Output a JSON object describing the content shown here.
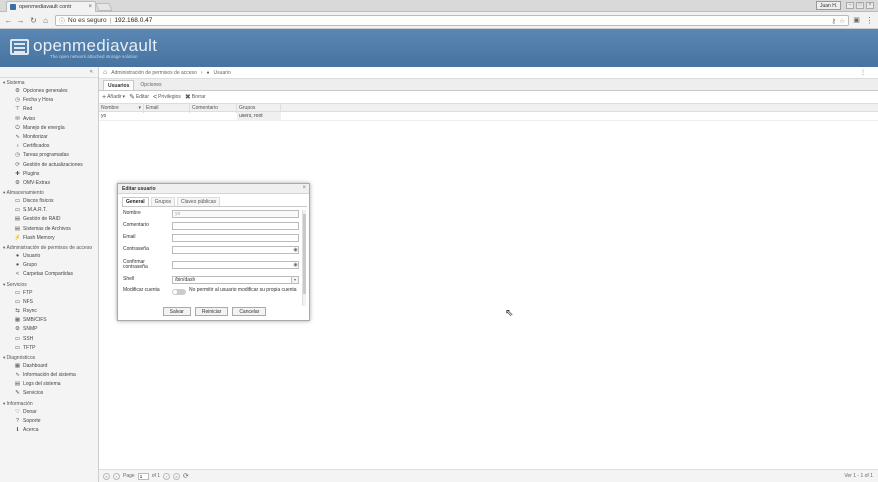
{
  "browser": {
    "tab_title": "openmediavault contr",
    "tab_close": "×",
    "user_badge": "Juan H.",
    "url_security": "No es seguro",
    "url_separator": "|",
    "url": "192.168.0.47"
  },
  "header": {
    "brand": "openmediavault",
    "tagline": "The open network attached storage solution"
  },
  "sidebar": {
    "sections": [
      {
        "label": "Sistema",
        "items": [
          {
            "label": "Opciones generales",
            "icon": "⚙"
          },
          {
            "label": "Fecha y Hora",
            "icon": "◷"
          },
          {
            "label": "Red",
            "icon": "⊤"
          },
          {
            "label": "Aviso",
            "icon": "✉"
          },
          {
            "label": "Manejo de energía",
            "icon": "⏻"
          },
          {
            "label": "Monitorizar",
            "icon": "∿"
          },
          {
            "label": "Certificados",
            "icon": "♁"
          },
          {
            "label": "Tareas programadas",
            "icon": "◷"
          },
          {
            "label": "Gestión de actualizaciones",
            "icon": "⟳"
          },
          {
            "label": "Plugins",
            "icon": "✚"
          },
          {
            "label": "OMV-Extras",
            "icon": "⚙"
          }
        ]
      },
      {
        "label": "Almacenamiento",
        "items": [
          {
            "label": "Discos físicos",
            "icon": "▭"
          },
          {
            "label": "S.M.A.R.T.",
            "icon": "▭"
          },
          {
            "label": "Gestión de RAID",
            "icon": "▤"
          },
          {
            "label": "Sistemas de Archivos",
            "icon": "▤"
          },
          {
            "label": "Flash Memory",
            "icon": "⚡"
          }
        ]
      },
      {
        "label": "Administración de permisos de acceso",
        "items": [
          {
            "label": "Usuario",
            "icon": "●"
          },
          {
            "label": "Grupo",
            "icon": "●"
          },
          {
            "label": "Carpetas Compartidas",
            "icon": "<"
          }
        ]
      },
      {
        "label": "Servicios",
        "items": [
          {
            "label": "FTP",
            "icon": "▭"
          },
          {
            "label": "NFS",
            "icon": "▭"
          },
          {
            "label": "Rsync",
            "icon": "⇆"
          },
          {
            "label": "SMB/CIFS",
            "icon": "▦"
          },
          {
            "label": "SNMP",
            "icon": "⚙"
          },
          {
            "label": "SSH",
            "icon": "▭"
          },
          {
            "label": "TFTP",
            "icon": "▭"
          }
        ]
      },
      {
        "label": "Diagnósticos",
        "items": [
          {
            "label": "Dashboard",
            "icon": "▦"
          },
          {
            "label": "Información del sistema",
            "icon": "∿"
          },
          {
            "label": "Logs del sistema",
            "icon": "▤"
          },
          {
            "label": "Servicios",
            "icon": "✎"
          }
        ]
      },
      {
        "label": "Información",
        "items": [
          {
            "label": "Donar",
            "icon": "♡"
          },
          {
            "label": "Soporte",
            "icon": "?"
          },
          {
            "label": "Acerca",
            "icon": "ℹ"
          }
        ]
      }
    ]
  },
  "breadcrumb": {
    "section": "Administración de permisos de acceso",
    "page": "Usuario"
  },
  "tabs": [
    "Usuarios",
    "Opciones"
  ],
  "toolbar": {
    "add": "Añadir",
    "edit": "Editar",
    "privileges": "Privilegios",
    "delete": "Borrar"
  },
  "grid": {
    "columns": [
      "Nombre",
      "Email",
      "Comentario",
      "Grupos"
    ],
    "rows": [
      [
        "yo",
        "",
        "",
        "users, root"
      ]
    ]
  },
  "pager": {
    "page_label": "Page",
    "page_value": "1",
    "of_label": "of 1",
    "info": "Ver 1 - 1 of 1"
  },
  "dialog": {
    "title": "Editar usuario",
    "tabs": [
      "General",
      "Grupos",
      "Claves públicas"
    ],
    "fields": {
      "nombre_label": "Nombre",
      "nombre_value": "yo",
      "comentario_label": "Comentario",
      "email_label": "Email",
      "contrasena_label": "Contraseña",
      "confirmar_label": "Confirmar contraseña",
      "shell_label": "Shell",
      "shell_value": "/bin/dash",
      "modificar_label": "Modificar cuenta",
      "modificar_text": "No permitir al usuario modificar su propia cuenta"
    },
    "buttons": {
      "save": "Salvar",
      "reset": "Reiniciar",
      "cancel": "Cancelar"
    }
  }
}
